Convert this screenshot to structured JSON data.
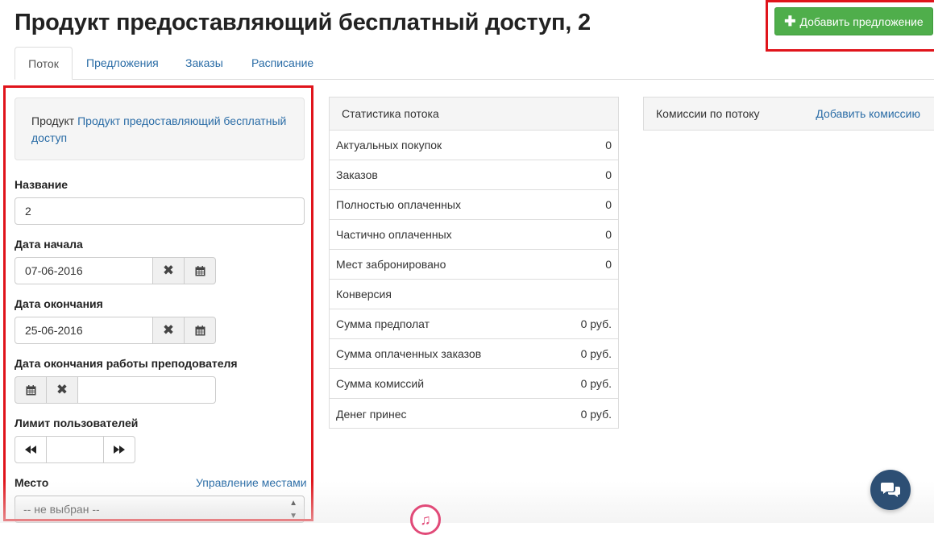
{
  "page": {
    "title": "Продукт предоставляющий бесплатный доступ, 2"
  },
  "header": {
    "add_offer_label": "Добавить предложение"
  },
  "tabs": [
    {
      "label": "Поток",
      "active": true
    },
    {
      "label": "Предложения"
    },
    {
      "label": "Заказы"
    },
    {
      "label": "Расписание"
    }
  ],
  "product": {
    "prefix": "Продукт",
    "link": "Продукт предоставляющий бесплатный доступ"
  },
  "form": {
    "name": {
      "label": "Название",
      "value": "2"
    },
    "start_date": {
      "label": "Дата начала",
      "value": "07-06-2016"
    },
    "end_date": {
      "label": "Дата окончания",
      "value": "25-06-2016"
    },
    "teacher_end": {
      "label": "Дата окончания работы преподователя",
      "value": ""
    },
    "user_limit": {
      "label": "Лимит пользователей",
      "value": ""
    },
    "place": {
      "label": "Место",
      "manage_link": "Управление местами",
      "selected": "-- не выбран --"
    }
  },
  "stats": {
    "title": "Статистика потока",
    "rows": [
      {
        "label": "Актуальных покупок",
        "value": "0"
      },
      {
        "label": "Заказов",
        "value": "0"
      },
      {
        "label": "Полностью оплаченных",
        "value": "0"
      },
      {
        "label": "Частично оплаченных",
        "value": "0"
      },
      {
        "label": "Мест забронировано",
        "value": "0"
      },
      {
        "label": "Конверсия",
        "value": ""
      },
      {
        "label": "Сумма предполат",
        "value": "0 руб."
      },
      {
        "label": "Сумма оплаченных заказов",
        "value": "0 руб."
      },
      {
        "label": "Сумма комиссий",
        "value": "0 руб."
      },
      {
        "label": "Денег принес",
        "value": "0 руб."
      }
    ]
  },
  "commissions": {
    "title": "Комиссии по потоку",
    "add_link": "Добавить комиссию"
  },
  "icons": {
    "plus": "plus-icon",
    "clear": "times-icon",
    "calendar": "calendar-icon",
    "backward": "backward-icon",
    "forward": "forward-icon",
    "chat": "chat-bubbles-icon",
    "music": "music-note-icon"
  },
  "colors": {
    "accent": "#2a6ca6",
    "add_button": "#4fae4b",
    "highlight": "#e0141b",
    "chat": "#2d4f74"
  }
}
